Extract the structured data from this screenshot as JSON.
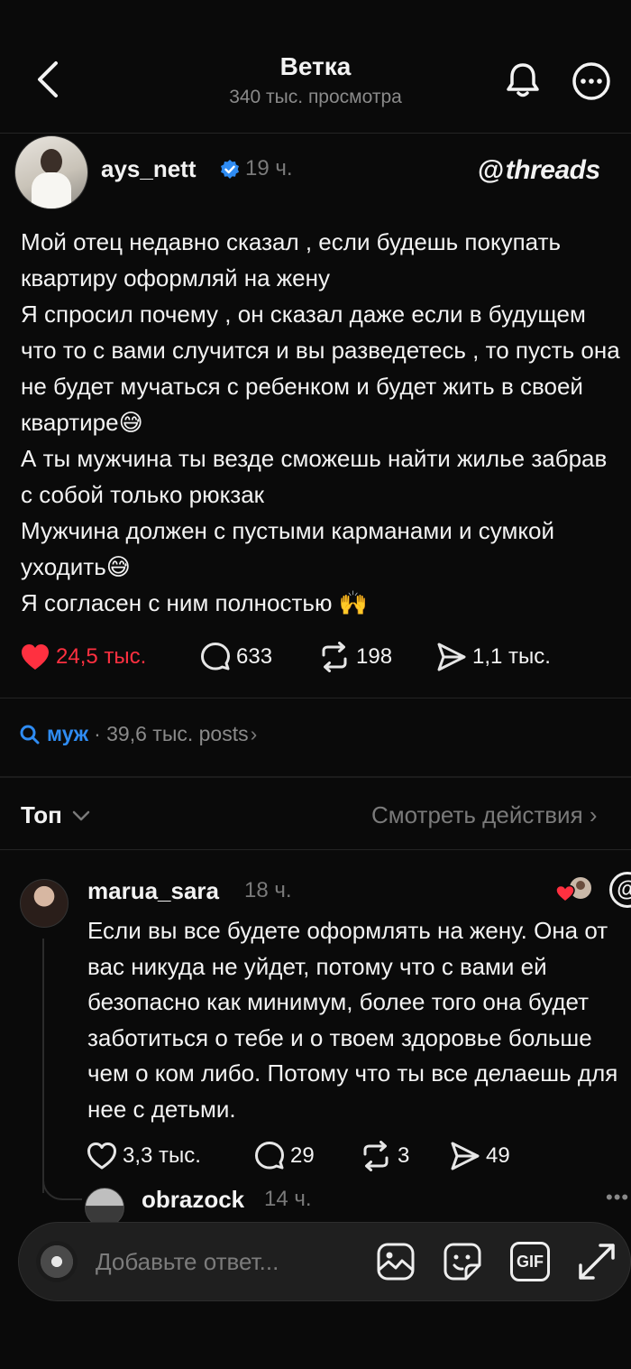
{
  "header": {
    "title": "Ветка",
    "subtitle": "340 тыс. просмотра"
  },
  "post": {
    "username": "ays_nett",
    "time": "19 ч.",
    "brand": "threads",
    "lines": [
      "Мой отец недавно сказал , если будешь покупать квартиру оформляй на жену",
      "Я спросил почему , он сказал даже если в будущем что то с вами случится и вы разведетесь , то пусть она не будет мучаться с ребенком и будет жить в своей квартире😅",
      "А ты мужчина ты везде сможешь найти жилье забрав с собой только рюкзак",
      "Мужчина должен с пустыми карманами и сумкой уходить😅",
      "Я согласен с ним полностью 🙌"
    ],
    "likes": "24,5 тыс.",
    "comments": "633",
    "reposts": "198",
    "shares": "1,1 тыс."
  },
  "topic": {
    "name": "муж",
    "count": "· 39,6 тыс. posts",
    "chevron": "›"
  },
  "sort": {
    "label": "Топ",
    "activity": "Смотреть действия ›"
  },
  "comment": {
    "username": "marua_sara",
    "time": "18 ч.",
    "text": "Если вы все будете оформлять на жену. Она от вас никуда не уйдет, потому что с вами ей безопасно как минимум, более того она будет заботиться о тебе и о твоем здоровье больше чем о ком либо. Потому что ты все делаешь для нее с детьми.",
    "likes": "3,3 тыс.",
    "comments": "29",
    "reposts": "3",
    "shares": "49",
    "threads_badge": "@"
  },
  "reply": {
    "username": "obrazock",
    "time": "14 ч.",
    "more": "•••"
  },
  "composer": {
    "placeholder": "Добавьте ответ...",
    "gif_label": "GIF"
  },
  "colors": {
    "background": "#0a0a0a",
    "like_red": "#ff3040",
    "verified_blue": "#2f8cf3",
    "muted": "#7a7a7a"
  }
}
